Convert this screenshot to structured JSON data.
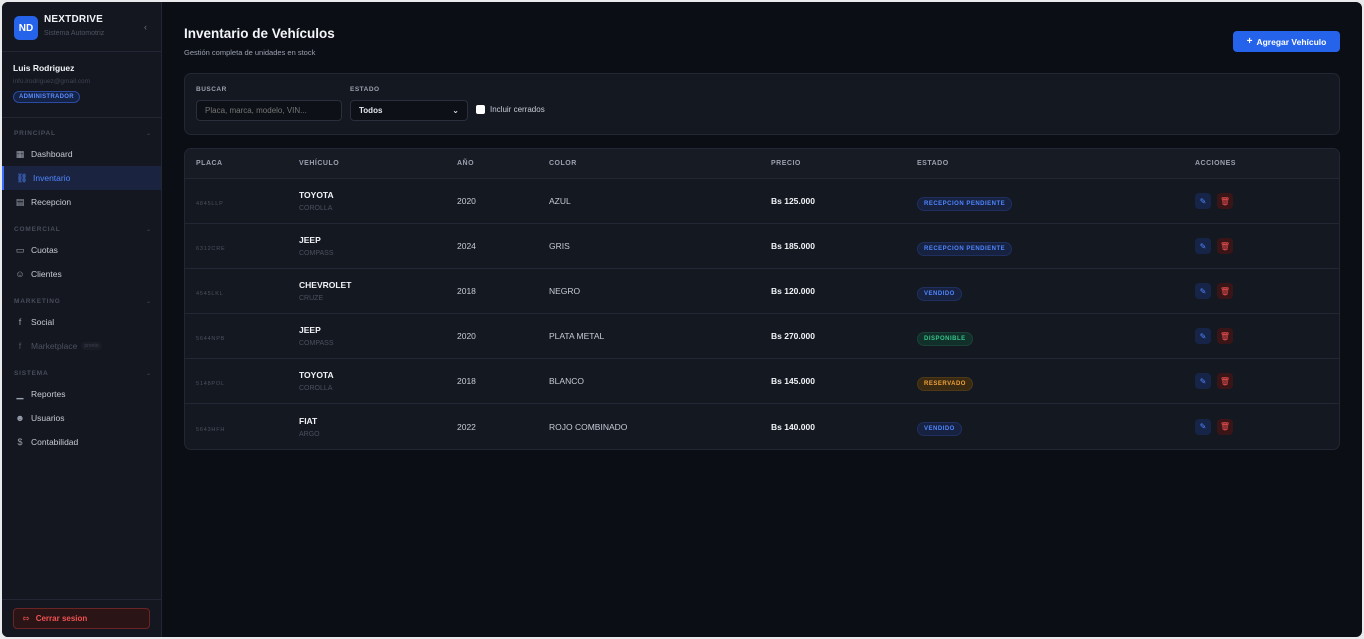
{
  "brand": {
    "logo": "ND",
    "name": "NEXTDRIVE",
    "subtitle": "Sistema Automotriz"
  },
  "user": {
    "name": "Luis Rodriguez",
    "email": "info.lrodriguez@gmail.com",
    "role": "ADMINISTRADOR"
  },
  "sidebar": {
    "sections": [
      {
        "title": "PRINCIPAL",
        "items": [
          {
            "label": "Dashboard",
            "icon": "grid-icon"
          },
          {
            "label": "Inventario",
            "icon": "car-icon",
            "active": true
          },
          {
            "label": "Recepcion",
            "icon": "document-icon"
          }
        ]
      },
      {
        "title": "COMERCIAL",
        "items": [
          {
            "label": "Cuotas",
            "icon": "credit-card-icon"
          },
          {
            "label": "Clientes",
            "icon": "users-icon"
          }
        ]
      },
      {
        "title": "MARKETING",
        "items": [
          {
            "label": "Social",
            "icon": "facebook-icon"
          },
          {
            "label": "Marketplace",
            "icon": "facebook-icon",
            "disabled": true,
            "tag": "pronto"
          }
        ]
      },
      {
        "title": "SISTEMA",
        "items": [
          {
            "label": "Reportes",
            "icon": "bar-chart-icon"
          },
          {
            "label": "Usuarios",
            "icon": "user-icon"
          },
          {
            "label": "Contabilidad",
            "icon": "dollar-icon"
          }
        ]
      }
    ],
    "logout_label": "Cerrar sesion"
  },
  "header": {
    "title": "Inventario de Vehículos",
    "subtitle": "Gestión completa de unidades en stock",
    "add_button": "Agregar Vehículo"
  },
  "filters": {
    "search_label": "BUSCAR",
    "search_placeholder": "Placa, marca, modelo, VIN...",
    "status_label": "ESTADO",
    "status_value": "Todos",
    "include_closed": "Incluir cerrados"
  },
  "table": {
    "headers": [
      "PLACA",
      "VEHÍCULO",
      "AÑO",
      "COLOR",
      "PRECIO",
      "ESTADO",
      "ACCIONES"
    ],
    "rows": [
      {
        "placa": "4845LLP",
        "marca": "TOYOTA",
        "modelo": "COROLLA",
        "anio": "2020",
        "color": "AZUL",
        "precio": "Bs 125.000",
        "estado": "RECEPCION PENDIENTE",
        "tone": "blue"
      },
      {
        "placa": "6312CRE",
        "marca": "JEEP",
        "modelo": "COMPASS",
        "anio": "2024",
        "color": "GRIS",
        "precio": "Bs 185.000",
        "estado": "RECEPCION PENDIENTE",
        "tone": "blue"
      },
      {
        "placa": "4545LKL",
        "marca": "CHEVROLET",
        "modelo": "CRUZE",
        "anio": "2018",
        "color": "NEGRO",
        "precio": "Bs 120.000",
        "estado": "VENDIDO",
        "tone": "blue"
      },
      {
        "placa": "5644NPB",
        "marca": "JEEP",
        "modelo": "COMPASS",
        "anio": "2020",
        "color": "PLATA METAL",
        "precio": "Bs 270.000",
        "estado": "DISPONIBLE",
        "tone": "green"
      },
      {
        "placa": "5148POL",
        "marca": "TOYOTA",
        "modelo": "COROLLA",
        "anio": "2018",
        "color": "BLANCO",
        "precio": "Bs 145.000",
        "estado": "RESERVADO",
        "tone": "amber"
      },
      {
        "placa": "5643HFH",
        "marca": "FIAT",
        "modelo": "ARGO",
        "anio": "2022",
        "color": "ROJO COMBINADO",
        "precio": "Bs 140.000",
        "estado": "VENDIDO",
        "tone": "blue"
      }
    ]
  },
  "colors": {
    "accent": "#2563eb",
    "danger": "#f05252",
    "success": "#35c48a",
    "warning": "#f0a13a"
  }
}
